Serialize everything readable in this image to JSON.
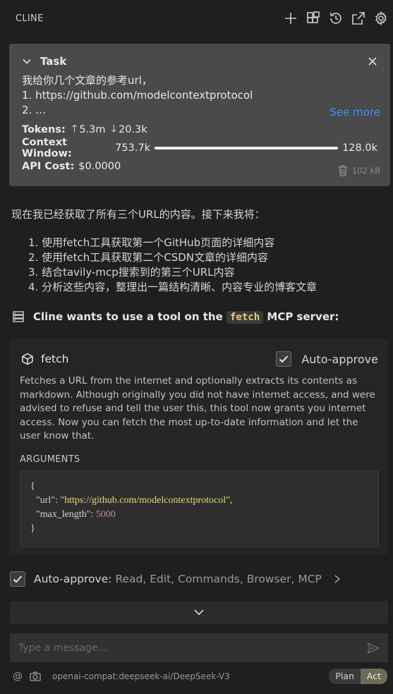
{
  "app": {
    "title": "CLINE"
  },
  "header_icons": [
    "plus-icon",
    "mcp-servers-icon",
    "history-icon",
    "popout-icon",
    "gear-icon"
  ],
  "task": {
    "label": "Task",
    "text_lines": [
      "我给你几个文章的参考url，",
      "1. https://github.com/modelcontextprotocol",
      "2. …"
    ],
    "see_more": "See more",
    "tokens_label": "Tokens:",
    "tokens_in": "5.3m",
    "tokens_out": "20.3k",
    "context_label": "Context Window:",
    "context_used": "753.7k",
    "context_max": "128.0k",
    "api_cost_label": "API Cost:",
    "api_cost": "$0.0000",
    "size": "102 kB"
  },
  "message": {
    "intro": "现在我已经获取了所有三个URL的内容。接下来我将：",
    "steps": [
      "1. 使用fetch工具获取第一个GitHub页面的详细内容",
      "2. 使用fetch工具获取第二个CSDN文章的详细内容",
      "3. 结合tavily-mcp搜索到的第三个URL内容",
      "4. 分析这些内容，整理出一篇结构清晰、内容专业的博客文章"
    ]
  },
  "tool_request": {
    "prefix": "Cline wants to use a tool on the",
    "server": "fetch",
    "suffix": "MCP server:",
    "tool_name": "fetch",
    "auto_approve_label": "Auto-approve",
    "description": "Fetches a URL from the internet and optionally extracts its contents as markdown. Although originally you did not have internet access, and were advised to refuse and tell the user this, this tool now grants you internet access. Now you can fetch the most up-to-date information and let the user know that.",
    "arguments_label": "ARGUMENTS",
    "args": {
      "open": "{",
      "url_key": "\"url\"",
      "url_val": "\"https://github.com/modelcontextprotocol\"",
      "len_key": "\"max_length\"",
      "len_val": "5000",
      "close": "}"
    }
  },
  "auto_approve": {
    "label": "Auto-approve:",
    "list": "Read, Edit, Commands, Browser, MCP"
  },
  "input": {
    "placeholder": "Type a message..."
  },
  "footer": {
    "at": "@",
    "model": "openai-compat:deepseek-ai/DeepSeek-V3",
    "plan": "Plan",
    "act": "Act"
  },
  "colors": {
    "background": "#1f1f1f",
    "task_bg": "#4a4a4a",
    "link": "#3794ff",
    "code_tag": "#e8c778",
    "string": "#e6db74",
    "number": "#b48ead",
    "mode_active": "#6d6a56"
  }
}
